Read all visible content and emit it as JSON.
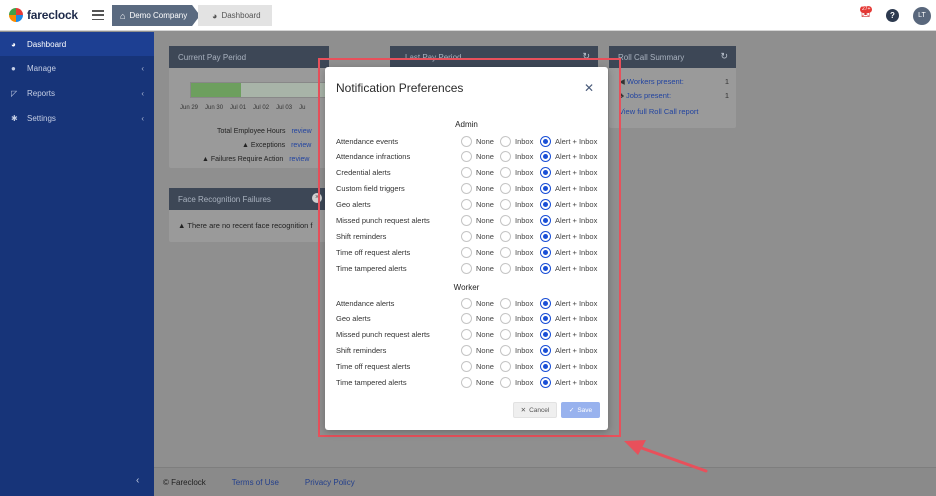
{
  "topbar": {
    "brand": "fareclock",
    "crumbs": {
      "company": "Demo Company",
      "page": "Dashboard"
    },
    "notification_count": "27+",
    "help_glyph": "?",
    "avatar_initials": "LT"
  },
  "sidebar": {
    "items": [
      {
        "label": "Dashboard",
        "icon": "dashboard-icon",
        "glyph": "◕"
      },
      {
        "label": "Manage",
        "icon": "user-icon",
        "glyph": "●"
      },
      {
        "label": "Reports",
        "icon": "chart-icon",
        "glyph": "◸"
      },
      {
        "label": "Settings",
        "icon": "gear-icon",
        "glyph": "✱"
      }
    ],
    "collapse_glyph": "‹"
  },
  "cards": {
    "current_pay_period": {
      "title": "Current Pay Period",
      "dates": [
        "Jun 29",
        "Jun 30",
        "Jul 01",
        "Jul 02",
        "Jul 03",
        "Ju"
      ],
      "stats": [
        {
          "label": "Total Employee Hours",
          "link": "review"
        },
        {
          "label": "Exceptions",
          "link": "review"
        },
        {
          "label": "Failures Require Action",
          "link": "review"
        }
      ]
    },
    "last_pay_period": {
      "title": "Last Pay Period"
    },
    "roll_call": {
      "title": "Roll Call Summary",
      "rows": [
        {
          "label": "Workers present:",
          "value": "1"
        },
        {
          "label": "Jobs present:",
          "value": "1"
        }
      ],
      "link": "View full Roll Call report"
    },
    "face_recognition": {
      "title": "Face Recognition Failures",
      "message": "There are no recent face recognition f"
    }
  },
  "footer": {
    "copyright": "© Fareclock",
    "terms": "Terms of Use",
    "privacy": "Privacy Policy"
  },
  "modal": {
    "title": "Notification Preferences",
    "options": {
      "none": "None",
      "inbox": "Inbox",
      "alert": "Alert + Inbox"
    },
    "admin": {
      "title": "Admin",
      "rows": [
        {
          "label": "Attendance events",
          "selected": "alert"
        },
        {
          "label": "Attendance infractions",
          "selected": "alert"
        },
        {
          "label": "Credential alerts",
          "selected": "alert"
        },
        {
          "label": "Custom field triggers",
          "selected": "alert"
        },
        {
          "label": "Geo alerts",
          "selected": "alert"
        },
        {
          "label": "Missed punch request alerts",
          "selected": "alert"
        },
        {
          "label": "Shift reminders",
          "selected": "alert"
        },
        {
          "label": "Time off request alerts",
          "selected": "alert"
        },
        {
          "label": "Time tampered alerts",
          "selected": "alert"
        }
      ]
    },
    "worker": {
      "title": "Worker",
      "rows": [
        {
          "label": "Attendance alerts",
          "selected": "alert"
        },
        {
          "label": "Geo alerts",
          "selected": "alert"
        },
        {
          "label": "Missed punch request alerts",
          "selected": "alert"
        },
        {
          "label": "Shift reminders",
          "selected": "alert"
        },
        {
          "label": "Time off request alerts",
          "selected": "alert"
        },
        {
          "label": "Time tampered alerts",
          "selected": "alert"
        }
      ]
    },
    "cancel_label": "Cancel",
    "save_label": "Save"
  },
  "colors": {
    "sidebar": "#173479",
    "accent": "#1a4fd6",
    "annotation": "#e8505b"
  }
}
